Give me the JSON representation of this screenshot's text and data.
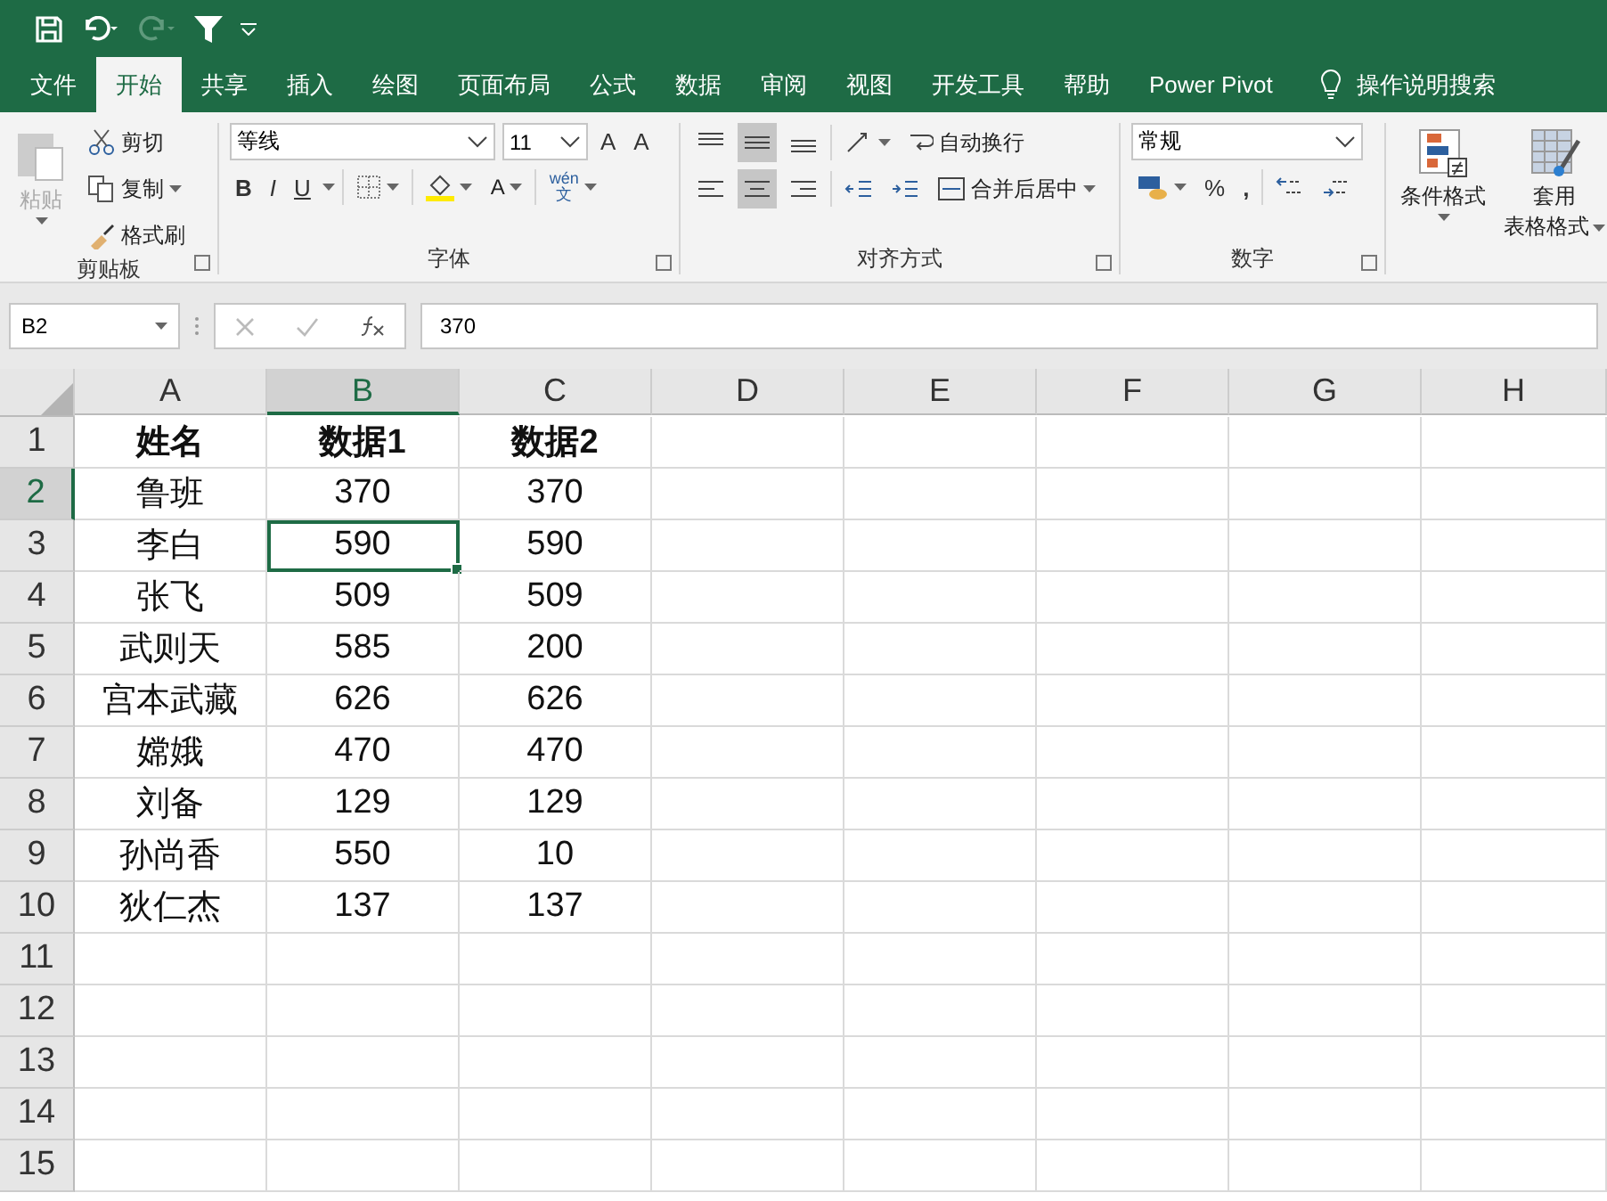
{
  "quick_access": {
    "undo_enabled": true,
    "redo_enabled": false
  },
  "tabs": [
    {
      "label": "文件",
      "selected": false
    },
    {
      "label": "开始",
      "selected": true
    },
    {
      "label": "共享",
      "selected": false
    },
    {
      "label": "插入",
      "selected": false
    },
    {
      "label": "绘图",
      "selected": false
    },
    {
      "label": "页面布局",
      "selected": false
    },
    {
      "label": "公式",
      "selected": false
    },
    {
      "label": "数据",
      "selected": false
    },
    {
      "label": "审阅",
      "selected": false
    },
    {
      "label": "视图",
      "selected": false
    },
    {
      "label": "开发工具",
      "selected": false
    },
    {
      "label": "帮助",
      "selected": false
    },
    {
      "label": "Power Pivot",
      "selected": false
    }
  ],
  "tell_me": "操作说明搜索",
  "ribbon": {
    "clipboard": {
      "paste": "粘贴",
      "paste_enabled": false,
      "cut": "剪切",
      "copy": "复制",
      "format_painter": "格式刷",
      "label": "剪贴板"
    },
    "font": {
      "name": "等线",
      "size": "11",
      "grow": "A",
      "shrink": "A",
      "bold": "B",
      "italic": "I",
      "underline": "U",
      "font_color_letter": "A",
      "phonetic_top": "wén",
      "phonetic_bottom": "文",
      "label": "字体"
    },
    "alignment": {
      "top_selected": false,
      "middle_selected": true,
      "bottom_selected": false,
      "left_selected": false,
      "center_selected": true,
      "right_selected": false,
      "wrap": "自动换行",
      "merge": "合并后居中",
      "label": "对齐方式"
    },
    "number": {
      "format": "常规",
      "percent": "%",
      "comma": ",",
      "label": "数字"
    },
    "styles": {
      "conditional": "条件格式",
      "table_line1": "套用",
      "table_line2": "表格格式"
    }
  },
  "formula_bar": {
    "name_box": "B2",
    "content": "370"
  },
  "columns": [
    {
      "label": "A",
      "selected": false
    },
    {
      "label": "B",
      "selected": true
    },
    {
      "label": "C",
      "selected": false
    },
    {
      "label": "D",
      "selected": false
    },
    {
      "label": "E",
      "selected": false
    },
    {
      "label": "F",
      "selected": false
    },
    {
      "label": "G",
      "selected": false
    },
    {
      "label": "H",
      "selected": false
    }
  ],
  "rows": [
    {
      "header": "1",
      "selected": false,
      "cells": [
        {
          "text": "姓名",
          "bold": true,
          "active": false
        },
        {
          "text": "数据1",
          "bold": true,
          "active": false
        },
        {
          "text": "数据2",
          "bold": true,
          "active": false
        }
      ]
    },
    {
      "header": "2",
      "selected": true,
      "cells": [
        {
          "text": "鲁班",
          "bold": false,
          "active": false
        },
        {
          "text": "370",
          "bold": false,
          "active": false
        },
        {
          "text": "370",
          "bold": false,
          "active": false
        }
      ]
    },
    {
      "header": "3",
      "selected": false,
      "cells": [
        {
          "text": "李白",
          "bold": false,
          "active": false
        },
        {
          "text": "590",
          "bold": false,
          "active": true
        },
        {
          "text": "590",
          "bold": false,
          "active": false
        }
      ]
    },
    {
      "header": "4",
      "selected": false,
      "cells": [
        {
          "text": "张飞",
          "bold": false,
          "active": false
        },
        {
          "text": "509",
          "bold": false,
          "active": false
        },
        {
          "text": "509",
          "bold": false,
          "active": false
        }
      ]
    },
    {
      "header": "5",
      "selected": false,
      "cells": [
        {
          "text": "武则天",
          "bold": false,
          "active": false
        },
        {
          "text": "585",
          "bold": false,
          "active": false
        },
        {
          "text": "200",
          "bold": false,
          "active": false
        }
      ]
    },
    {
      "header": "6",
      "selected": false,
      "cells": [
        {
          "text": "宫本武藏",
          "bold": false,
          "active": false
        },
        {
          "text": "626",
          "bold": false,
          "active": false
        },
        {
          "text": "626",
          "bold": false,
          "active": false
        }
      ]
    },
    {
      "header": "7",
      "selected": false,
      "cells": [
        {
          "text": "嫦娥",
          "bold": false,
          "active": false
        },
        {
          "text": "470",
          "bold": false,
          "active": false
        },
        {
          "text": "470",
          "bold": false,
          "active": false
        }
      ]
    },
    {
      "header": "8",
      "selected": false,
      "cells": [
        {
          "text": "刘备",
          "bold": false,
          "active": false
        },
        {
          "text": "129",
          "bold": false,
          "active": false
        },
        {
          "text": "129",
          "bold": false,
          "active": false
        }
      ]
    },
    {
      "header": "9",
      "selected": false,
      "cells": [
        {
          "text": "孙尚香",
          "bold": false,
          "active": false
        },
        {
          "text": "550",
          "bold": false,
          "active": false
        },
        {
          "text": "10",
          "bold": false,
          "active": false
        }
      ]
    },
    {
      "header": "10",
      "selected": false,
      "cells": [
        {
          "text": "狄仁杰",
          "bold": false,
          "active": false
        },
        {
          "text": "137",
          "bold": false,
          "active": false
        },
        {
          "text": "137",
          "bold": false,
          "active": false
        }
      ]
    },
    {
      "header": "11",
      "selected": false
    },
    {
      "header": "12",
      "selected": false
    },
    {
      "header": "13",
      "selected": false
    },
    {
      "header": "14",
      "selected": false
    },
    {
      "header": "15",
      "selected": false
    }
  ]
}
